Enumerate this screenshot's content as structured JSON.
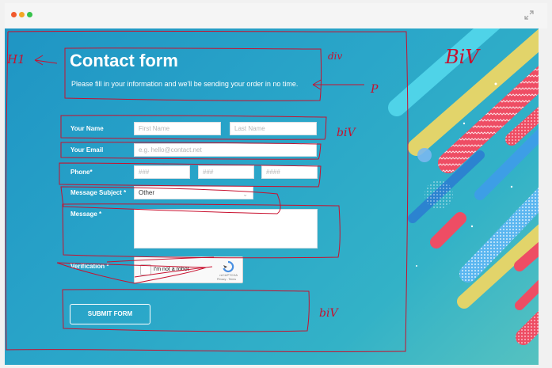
{
  "window": {
    "colors": {
      "close": "#f0592d",
      "minimize": "#f5a623",
      "maximize": "#36c24b"
    },
    "expand_icon": "expand-icon"
  },
  "form": {
    "title": "Contact form",
    "subtitle": "Please fill in your information and we'll be sending your order in no time.",
    "name_label": "Your Name",
    "first_name_placeholder": "First Name",
    "last_name_placeholder": "Last Name",
    "email_label": "Your Email",
    "email_placeholder": "e.g. hello@contact.net",
    "phone_label": "Phone*",
    "phone_placeholder_1": "###",
    "phone_placeholder_2": "###",
    "phone_placeholder_3": "####",
    "subject_label": "Message Subject *",
    "subject_value": "Other",
    "message_label": "Message *",
    "verification_label": "Verification *",
    "submit_label": "SUBMIT FORM"
  },
  "captcha": {
    "text": "I'm not a robot",
    "brand": "reCAPTCHA",
    "terms": "Privacy - Terms"
  },
  "annotations": {
    "h1": "H1",
    "div_top": "div",
    "p": "P",
    "biv_top": "BiV",
    "biv_mid": "biV",
    "biv_bottom": "biV"
  },
  "colors": {
    "background_start": "#1f95c4",
    "background_end": "#56c2c0",
    "annotation": "#c8102e",
    "stripe_pink": "#ee4d64",
    "stripe_yellow": "#e2d46a",
    "stripe_cyan": "#4fd3e8",
    "stripe_blue": "#3d9ee6"
  }
}
